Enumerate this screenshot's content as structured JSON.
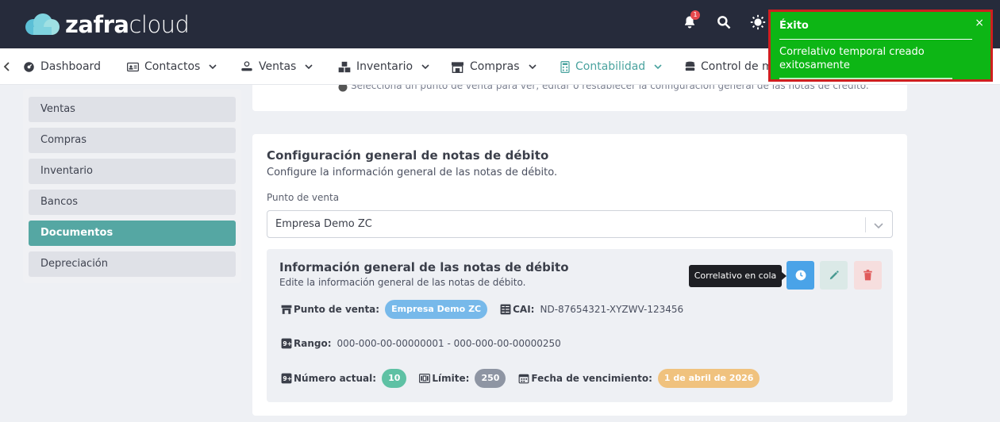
{
  "brand": {
    "logo_bold": "zafra",
    "logo_light": "cloud"
  },
  "header": {
    "notification_count": "1"
  },
  "nav": {
    "items": [
      {
        "label": "Dashboard"
      },
      {
        "label": "Contactos"
      },
      {
        "label": "Ventas"
      },
      {
        "label": "Inventario"
      },
      {
        "label": "Compras"
      },
      {
        "label": "Contabilidad"
      },
      {
        "label": "Control de me"
      }
    ]
  },
  "sidebar": {
    "items": [
      {
        "label": "Ventas"
      },
      {
        "label": "Compras"
      },
      {
        "label": "Inventario"
      },
      {
        "label": "Bancos"
      },
      {
        "label": "Documentos"
      },
      {
        "label": "Depreciación"
      }
    ],
    "active": "Documentos"
  },
  "top_card": {
    "clipped_text": "Selecciona un punto de venta para ver, editar o restablecer la configuración general de las notas de crédito."
  },
  "main": {
    "title": "Configuración general de notas de débito",
    "subtitle": "Configure la información general de las notas de débito.",
    "pv_label": "Punto de venta",
    "pv_selected": "Empresa Demo ZC",
    "info": {
      "title": "Información general de las notas de débito",
      "subtitle": "Edite la información general de las notas de débito.",
      "tooltip": "Correlativo en cola",
      "punto_label": "Punto de venta:",
      "punto_value": "Empresa Demo ZC",
      "cai_label": "CAI:",
      "cai_value": "ND-87654321-XYZWV-123456",
      "rango_label": "Rango:",
      "rango_value": "000-000-00-00000001 - 000-000-00-00000250",
      "numero_label": "Número actual:",
      "numero_value": "10",
      "limite_label": "Límite:",
      "limite_value": "250",
      "fecha_label": "Fecha de vencimiento:",
      "fecha_value": "1 de abril de 2026"
    }
  },
  "toast": {
    "title": "Éxito",
    "close": "×",
    "message": "Correlativo temporal creado exitosamente",
    "color": "#0db615"
  }
}
